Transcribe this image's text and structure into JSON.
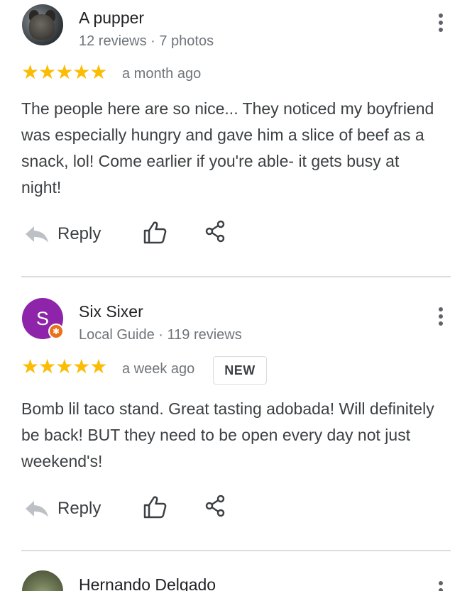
{
  "reviews": [
    {
      "author": "A pupper",
      "meta": "12 reviews · 7 photos",
      "rating": 5,
      "stars": "★★★★★",
      "time": "a month ago",
      "text": "The people here are so nice... They noticed my boyfriend was especially hungry and gave him a slice of beef as a snack, lol! Come earlier if you're able- it gets busy at night!",
      "reply_label": "Reply"
    },
    {
      "author": "Six Sixer",
      "avatar_letter": "S",
      "avatar_color": "#8e24aa",
      "meta": "Local Guide · 119 reviews",
      "rating": 5,
      "stars": "★★★★★",
      "time": "a week ago",
      "badge": "NEW",
      "text": "Bomb lil taco stand. Great tasting adobada! Will definitely be back! BUT they need to be open every day not just weekend's!",
      "reply_label": "Reply"
    },
    {
      "author": "Hernando Delgado"
    }
  ],
  "colors": {
    "star": "#fbbc04",
    "icon": "#5f6368",
    "reply_icon": "#bdc1c6",
    "divider": "#dadce0"
  },
  "icons": {
    "more": "more-vert-icon",
    "reply": "reply-arrow-icon",
    "like": "thumbs-up-icon",
    "share": "share-icon",
    "guide": "local-guide-star-icon"
  }
}
